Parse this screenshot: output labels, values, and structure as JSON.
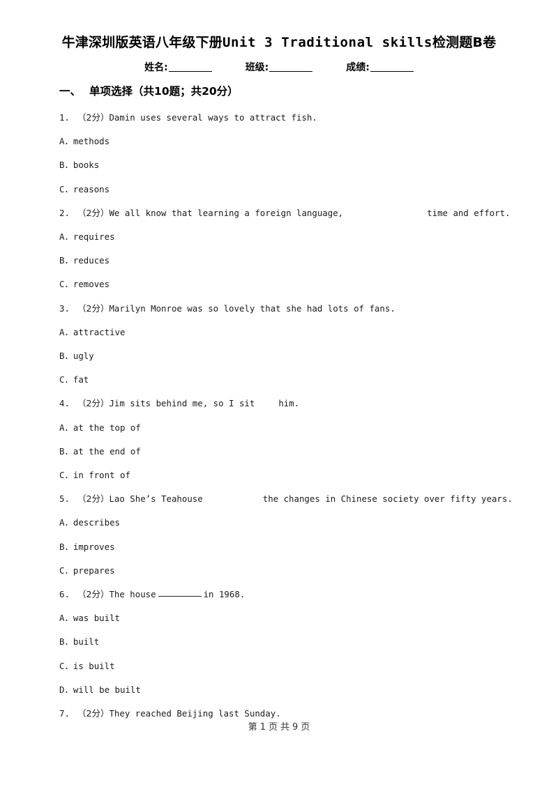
{
  "document": {
    "title_cn_prefix": "牛津深圳版英语八年级下册",
    "title_en": "Unit 3 Traditional skills",
    "title_cn_suffix": "检测题B卷",
    "title_full": "牛津深圳版英语八年级下册Unit 3 Traditional skills检测题B卷"
  },
  "info_line": {
    "name_label": "姓名:",
    "class_label": "班级:",
    "score_label": "成绩:"
  },
  "section": {
    "number": "一、",
    "name": "单项选择",
    "meta": "（共10题；共20分）"
  },
  "questions": [
    {
      "num": "1.",
      "score": "（2分）",
      "text": "Damin uses several ways to attract fish.",
      "options": [
        {
          "letter": "A．",
          "text": "methods"
        },
        {
          "letter": "B．",
          "text": "books"
        },
        {
          "letter": "C．",
          "text": "reasons"
        }
      ]
    },
    {
      "num": "2.",
      "score": "（2分）",
      "text_before": "We all know that learning a foreign language,",
      "gap": "blank-wide",
      "text_after": "time and effort.",
      "options": [
        {
          "letter": "A．",
          "text": "requires"
        },
        {
          "letter": "B．",
          "text": "reduces"
        },
        {
          "letter": "C．",
          "text": "removes"
        }
      ]
    },
    {
      "num": "3.",
      "score": "（2分）",
      "text": "Marilyn Monroe was so lovely that she had lots of fans.",
      "options": [
        {
          "letter": "A．",
          "text": "attractive"
        },
        {
          "letter": "B．",
          "text": "ugly"
        },
        {
          "letter": "C．",
          "text": "fat"
        }
      ]
    },
    {
      "num": "4.",
      "score": "（2分）",
      "text_before": "Jim sits behind me, so I sit",
      "gap": "blank-small",
      "text_after": "him.",
      "options": [
        {
          "letter": "A．",
          "text": "at the top of"
        },
        {
          "letter": "B．",
          "text": "at the end of"
        },
        {
          "letter": "C．",
          "text": "in front of"
        }
      ]
    },
    {
      "num": "5.",
      "score": "（2分）",
      "text_before": "Lao She’s Teahouse",
      "gap": "blank-wide",
      "text_after": "the changes in Chinese society over fifty years.",
      "options": [
        {
          "letter": "A．",
          "text": "describes"
        },
        {
          "letter": "B．",
          "text": "improves"
        },
        {
          "letter": "C．",
          "text": "prepares"
        }
      ]
    },
    {
      "num": "6.",
      "score": "（2分）",
      "text_before": "The house",
      "gap": "underline",
      "text_after": "in 1968.",
      "options": [
        {
          "letter": "A．",
          "text": "was built"
        },
        {
          "letter": "B．",
          "text": "built"
        },
        {
          "letter": "C．",
          "text": "is built"
        },
        {
          "letter": "D．",
          "text": "will be built"
        }
      ]
    },
    {
      "num": "7.",
      "score": "（2分）",
      "text": "They reached Beijing last Sunday.",
      "options": []
    }
  ],
  "footer": {
    "page_prefix": "第",
    "current_page": "1",
    "page_unit": "页",
    "total_prefix": "共",
    "total_pages": "9",
    "total_unit": "页"
  }
}
